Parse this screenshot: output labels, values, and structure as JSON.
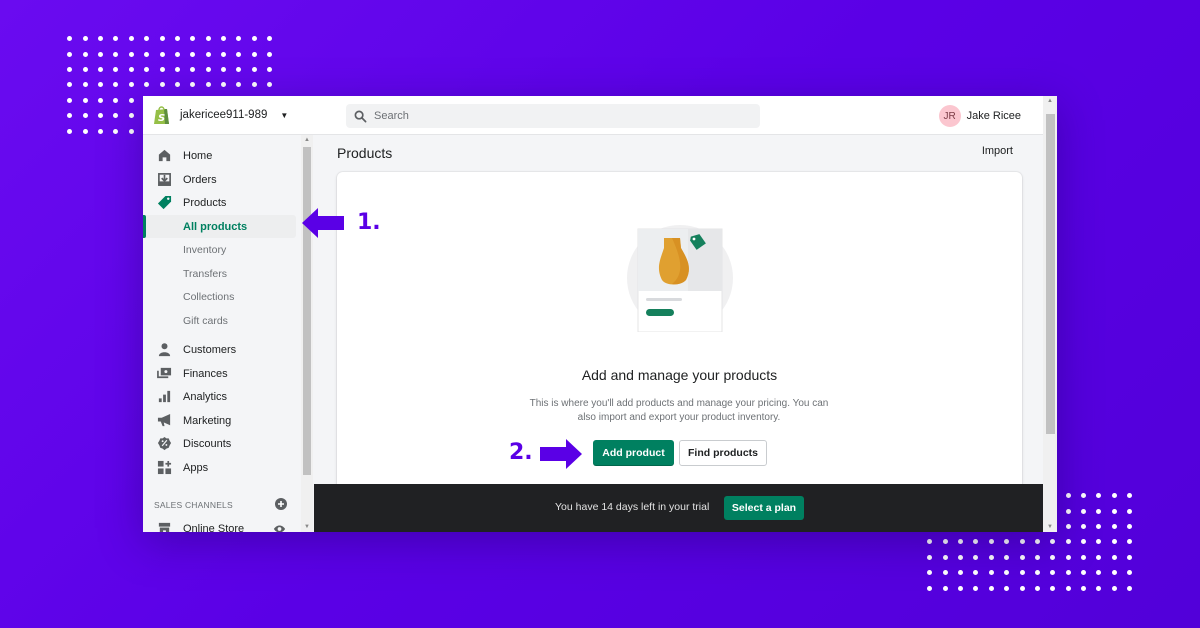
{
  "colors": {
    "background": "#5a00e6",
    "brand_green": "#008060",
    "callout_purple": "#5a00e6",
    "trial_bar": "#202123",
    "avatar_bg": "#fbc6cf"
  },
  "topbar": {
    "logo_icon": "shopify-bag-icon",
    "store_name": "jakericee911-989",
    "store_caret": "▼",
    "search_placeholder": "Search",
    "user_initials": "JR",
    "user_name": "Jake Ricee"
  },
  "sidebar": {
    "items": [
      {
        "label": "Home",
        "icon": "home-icon"
      },
      {
        "label": "Orders",
        "icon": "orders-icon"
      },
      {
        "label": "Products",
        "icon": "tag-icon"
      },
      {
        "label": "All products",
        "sub": true,
        "active": true
      },
      {
        "label": "Inventory",
        "sub": true
      },
      {
        "label": "Transfers",
        "sub": true
      },
      {
        "label": "Collections",
        "sub": true
      },
      {
        "label": "Gift cards",
        "sub": true
      },
      {
        "label": "Customers",
        "icon": "person-icon"
      },
      {
        "label": "Finances",
        "icon": "finances-icon"
      },
      {
        "label": "Analytics",
        "icon": "bar-chart-icon"
      },
      {
        "label": "Marketing",
        "icon": "megaphone-icon"
      },
      {
        "label": "Discounts",
        "icon": "discount-icon"
      },
      {
        "label": "Apps",
        "icon": "apps-icon"
      }
    ],
    "sales_channels_heading": "SALES CHANNELS",
    "online_store": "Online Store"
  },
  "main": {
    "page_title": "Products",
    "import_label": "Import",
    "empty_state": {
      "title": "Add and manage your products",
      "description": "This is where you'll add products and manage your pricing. You can also import and export your product inventory.",
      "primary_label": "Add product",
      "secondary_label": "Find products"
    }
  },
  "trial": {
    "text": "You have 14 days left in your trial",
    "button_label": "Select a plan"
  },
  "callouts": {
    "step1": "1.",
    "step2": "2."
  }
}
